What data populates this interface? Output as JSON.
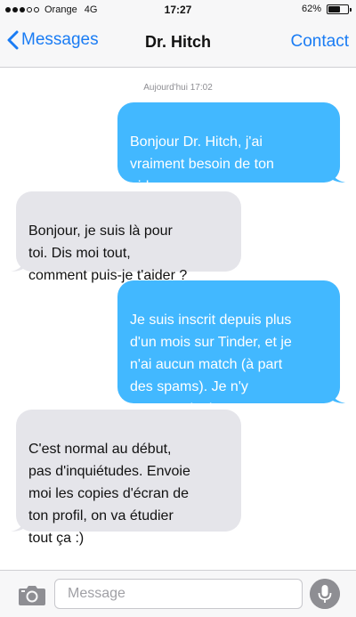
{
  "status": {
    "carrier": "Orange",
    "network": "4G",
    "time": "17:27",
    "battery_percent_label": "62%",
    "battery_level": 0.62,
    "signal_bars_filled": 3,
    "signal_bars_total": 5
  },
  "nav": {
    "back_label": "Messages",
    "title": "Dr. Hitch",
    "contact_label": "Contact"
  },
  "conversation": {
    "timestamp": "Aujourd'hui 17:02",
    "messages": [
      {
        "direction": "outgoing",
        "text": "Bonjour Dr. Hitch, j'ai\nvraiment besoin de ton\naide...."
      },
      {
        "direction": "incoming",
        "text": "Bonjour, je suis là pour\ntoi. Dis moi tout,\ncomment puis-je t'aider ?"
      },
      {
        "direction": "outgoing",
        "text": "Je suis inscrit depuis plus\nd'un mois sur Tinder, et je\nn'ai aucun match (à part\ndes spams). Je n'y\ncomprends rien..."
      },
      {
        "direction": "incoming",
        "text": "C'est normal au début,\npas d'inquiétudes. Envoie\nmoi les copies d'écran de\nton profil, on va étudier\ntout ça :)"
      }
    ]
  },
  "composer": {
    "placeholder": "Message",
    "value": ""
  },
  "icons": {
    "back": "chevron-left-icon",
    "camera": "camera-icon",
    "mic": "microphone-icon"
  },
  "colors": {
    "accent": "#1a7cf4",
    "outgoing_bubble": "#42b8ff",
    "incoming_bubble": "#e5e5ea"
  }
}
